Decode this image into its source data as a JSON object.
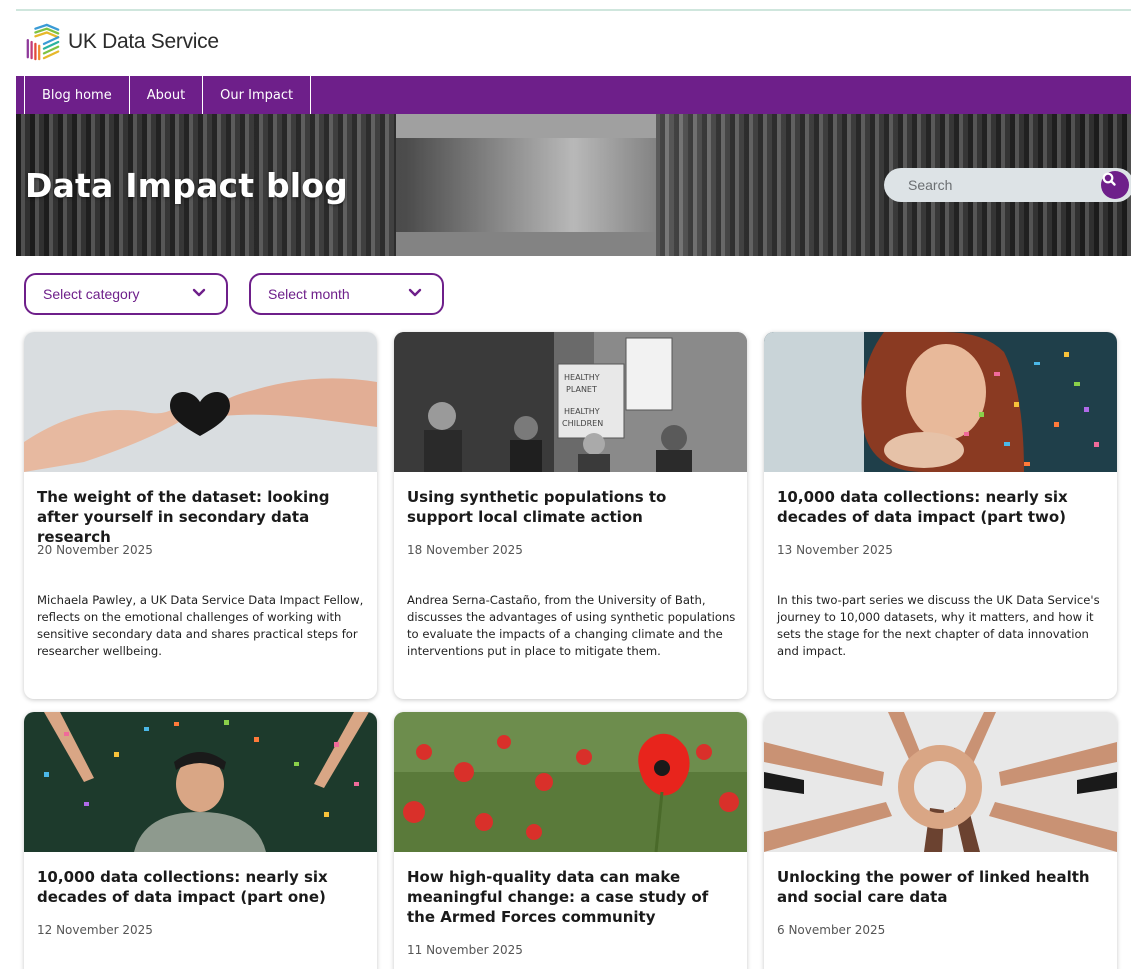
{
  "brand": {
    "name": "UK Data Service",
    "accent_color": "#6e1f8a"
  },
  "nav": {
    "items": [
      {
        "label": "Blog home"
      },
      {
        "label": "About"
      },
      {
        "label": "Our Impact"
      }
    ]
  },
  "hero": {
    "title": "Data Impact blog"
  },
  "search": {
    "placeholder": "Search",
    "icon": "search-icon"
  },
  "filters": {
    "category_label": "Select category",
    "month_label": "Select month"
  },
  "posts": [
    {
      "title": "The weight of the dataset: looking after yourself in secondary data research",
      "date": "20 November 2025",
      "summary": "Michaela Pawley, a UK Data Service Data Impact Fellow, reflects on the emotional challenges of working with sensitive secondary data and shares practical steps for researcher wellbeing."
    },
    {
      "title": "Using synthetic populations to support local climate action",
      "date": "18 November 2025",
      "summary": "Andrea Serna-Castaño, from the University of Bath, discusses the advantages of using synthetic populations to evaluate the impacts of a changing climate and the interventions put in place to mitigate them."
    },
    {
      "title": "10,000 data collections: nearly six decades of data impact (part two)",
      "date": "13 November 2025",
      "summary": "In this two-part series we discuss the UK Data Service's journey to 10,000 datasets, why it matters, and how it sets the stage for the next chapter of data innovation and impact."
    },
    {
      "title": "10,000 data collections: nearly six decades of data impact (part one)",
      "date": "12 November 2025",
      "summary": ""
    },
    {
      "title": "How high-quality data can make meaningful change: a case study of the Armed Forces community",
      "date": "11 November 2025",
      "summary": ""
    },
    {
      "title": "Unlocking the power of linked health and social care data",
      "date": "6 November 2025",
      "summary": ""
    }
  ],
  "image_texts": {
    "placard_1": "HEALTHY PLANET = HEALTHY CHILDREN"
  }
}
